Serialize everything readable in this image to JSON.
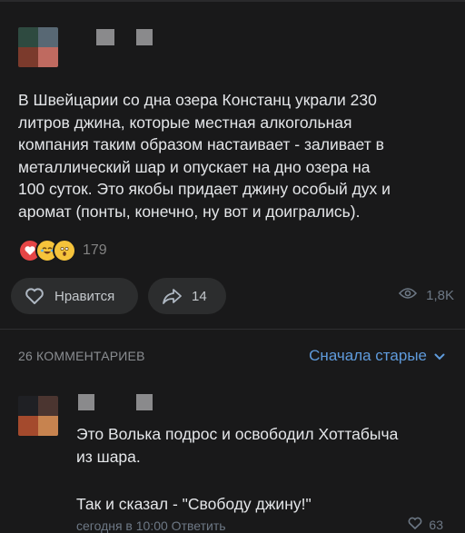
{
  "post": {
    "avatar_colors": [
      "#2e4a40",
      "#586874",
      "#7b3a2c",
      "#bf6a60"
    ],
    "text": "В Швейцарии со дна озера Констанц украли 230\nлитров джина, которые местная алкогольная\nкомпания таким образом настаивает - заливает в\nметаллический шар и опускает на дно озера на\n100 суток. Это якобы придает джину особый дух и\nаромат (понты, конечно, ну вот и доигрались).",
    "reactions": {
      "icons": [
        "heart-eyes-icon",
        "laughing-icon",
        "astonished-icon"
      ],
      "count": "179"
    },
    "actions": {
      "like_label": "Нравится",
      "share_count": "14",
      "views": "1,8K"
    }
  },
  "comments_header": {
    "count_label": "26 КОММЕНТАРИЕВ",
    "sort_label": "Сначала старые",
    "accent": "#5f9bdc"
  },
  "comment": {
    "avatar_colors": [
      "#1f2024",
      "#4b3530",
      "#a44a2d",
      "#c7834f"
    ],
    "text_line1": "Это Волька подрос и освободил Хоттабыча\nиз шара.",
    "text_line2": "Так и сказал - \"Свободу джину!\"",
    "meta": "сегодня в 10:00   Ответить",
    "likes": "63"
  }
}
